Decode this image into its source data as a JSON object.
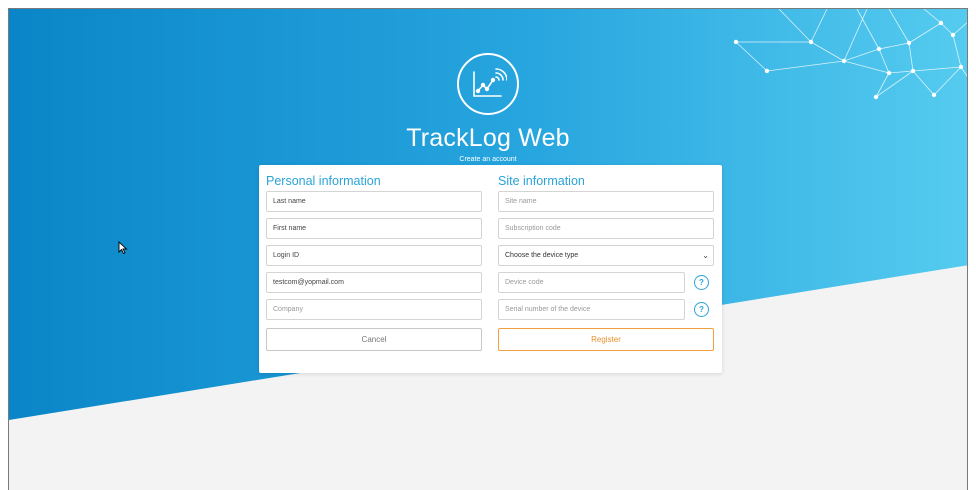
{
  "app": {
    "title": "TrackLog Web",
    "subtitle": "Create an account"
  },
  "personal": {
    "title": "Personal information",
    "last_name": "Last name",
    "first_name": "First name",
    "login_id": "Login ID",
    "email": "testcom@yopmail.com",
    "company_placeholder": "Company"
  },
  "site": {
    "title": "Site information",
    "site_name_placeholder": "Site name",
    "subscription_placeholder": "Subscription code",
    "device_type": "Choose the device type",
    "device_code_placeholder": "Device code",
    "serial_placeholder": "Serial number of the device",
    "help_glyph": "?"
  },
  "buttons": {
    "cancel": "Cancel",
    "register": "Register"
  },
  "colors": {
    "accent": "#2aa3d8",
    "register": "#e8912b",
    "bg_dark": "#0a88cc",
    "bg_light": "#52c9ee"
  },
  "icons": [
    "tracklog-logo-icon",
    "chevron-down-icon",
    "help-icon",
    "mouse-cursor-icon",
    "network-mesh-decoration"
  ]
}
